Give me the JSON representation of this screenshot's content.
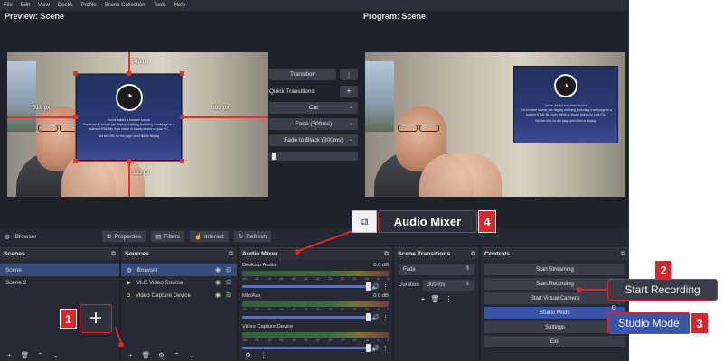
{
  "menu": [
    "File",
    "Edit",
    "View",
    "Docks",
    "Profile",
    "Scene Collection",
    "Tools",
    "Help"
  ],
  "preview": {
    "title": "Preview: Scene",
    "dims": {
      "top": "149 px",
      "left": "518 px",
      "right": "609 px",
      "bottom": "333 px"
    }
  },
  "program": {
    "title": "Program: Scene"
  },
  "browser_source_text": [
    "You've added a browser source",
    "The browser source can display anything, including a webpage or a custom HTML file, from online or locally stored on your PC.",
    "Set the URL for the page you'd like to display"
  ],
  "transitions_panel": {
    "transition": "Transition",
    "quick_transitions": "Quick Transitions",
    "cut": "Cut",
    "fade": "Fade (300ms)",
    "fade_black": "Fade to Black (300ms)",
    "more": "⋮",
    "add": "+"
  },
  "toolbar": {
    "source_name": "Browser",
    "properties": "Properties",
    "filters": "Filters",
    "interact": "Interact",
    "refresh": "Refresh"
  },
  "docks": {
    "scenes": {
      "title": "Scenes",
      "items": [
        "Scene",
        "Scene 2"
      ]
    },
    "sources": {
      "title": "Sources",
      "items": [
        {
          "name": "Browser",
          "icon": "globe-icon"
        },
        {
          "name": "VLC Video Source",
          "icon": "play-icon"
        },
        {
          "name": "Video Capture Device",
          "icon": "camera-icon"
        }
      ]
    },
    "audio_mixer": {
      "title": "Audio Mixer",
      "channels": [
        {
          "name": "Desktop Audio",
          "level": "0.0 dB",
          "volume": 1.0
        },
        {
          "name": "Mic/Aux",
          "level": "0.0 dB",
          "volume": 1.0
        },
        {
          "name": "Video Capture Device",
          "level": "",
          "volume": 1.0
        }
      ],
      "scale": [
        "-60",
        "-55",
        "-50",
        "-45",
        "-40",
        "-35",
        "-30",
        "-25",
        "-20",
        "-15",
        "-10",
        "-5",
        "0"
      ]
    },
    "scene_transitions": {
      "title": "Scene Transitions",
      "transition": "Fade",
      "duration_label": "Duration",
      "duration_value": "300 ms"
    },
    "controls": {
      "title": "Controls",
      "buttons": [
        "Start Streaming",
        "Start Recording",
        "Start Virtual Camera",
        "Studio Mode",
        "Settings",
        "Exit"
      ],
      "active": "Studio Mode"
    }
  },
  "callouts": {
    "c1": {
      "num": "1",
      "glyph": "+"
    },
    "c2": {
      "num": "2",
      "label": "Start Recording"
    },
    "c3": {
      "num": "3",
      "label": "Studio Mode"
    },
    "c4": {
      "num": "4",
      "label": "Audio Mixer"
    }
  },
  "colors": {
    "accent_red": "#d8262b",
    "selection_blue": "#344b7b",
    "obs_bg": "#1f222b",
    "active_button": "#3a55a5"
  }
}
